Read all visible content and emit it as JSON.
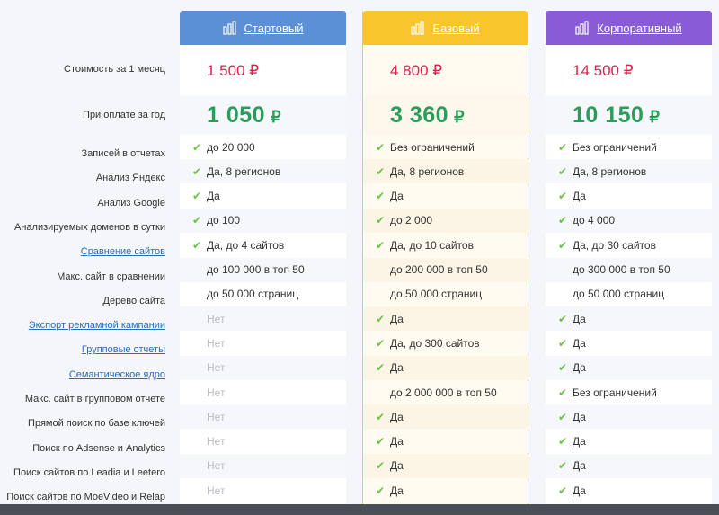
{
  "labels": {
    "monthly_cost": "Стоимость за 1 месяц",
    "yearly_payment": "При оплате за год",
    "features": [
      {
        "text": "Записей в отчетах",
        "link": false
      },
      {
        "text": "Анализ Яндекс",
        "link": false
      },
      {
        "text": "Анализ Google",
        "link": false
      },
      {
        "text": "Анализируемых доменов в сутки",
        "link": false
      },
      {
        "text": "Сравнение сайтов",
        "link": true
      },
      {
        "text": "Макс. сайт в сравнении",
        "link": false
      },
      {
        "text": "Дерево сайта",
        "link": false
      },
      {
        "text": "Экспорт рекламной кампании",
        "link": true
      },
      {
        "text": "Групповые отчеты",
        "link": true
      },
      {
        "text": "Семантическое ядро",
        "link": true
      },
      {
        "text": "Макс. сайт в групповом отчете",
        "link": false
      },
      {
        "text": "Прямой поиск по базе ключей",
        "link": false
      },
      {
        "text": "Поиск по Adsense и Analytics",
        "link": false
      },
      {
        "text": "Поиск сайтов по Leadia и Leetero",
        "link": false
      },
      {
        "text": "Поиск сайтов по MoeVideo и Relap",
        "link": false
      }
    ]
  },
  "plans": [
    {
      "key": "start",
      "name": "Стартовый",
      "color": "#5b8fd6",
      "month_price": "1 500 ₽",
      "year_price": "1 050",
      "currency": "₽",
      "values": [
        {
          "text": "до 20 000",
          "state": "check"
        },
        {
          "text": "Да, 8 регионов",
          "state": "check"
        },
        {
          "text": "Да",
          "state": "check"
        },
        {
          "text": "до 100",
          "state": "check"
        },
        {
          "text": "Да, до 4 сайтов",
          "state": "check"
        },
        {
          "text": "до 100 000 в топ 50",
          "state": "plain"
        },
        {
          "text": "до 50 000 страниц",
          "state": "plain"
        },
        {
          "text": "Нет",
          "state": "no"
        },
        {
          "text": "Нет",
          "state": "no"
        },
        {
          "text": "Нет",
          "state": "no"
        },
        {
          "text": "Нет",
          "state": "no"
        },
        {
          "text": "Нет",
          "state": "no"
        },
        {
          "text": "Нет",
          "state": "no"
        },
        {
          "text": "Нет",
          "state": "no"
        },
        {
          "text": "Нет",
          "state": "no"
        }
      ]
    },
    {
      "key": "basic",
      "name": "Базовый",
      "color": "#f7c52c",
      "month_price": "4 800 ₽",
      "year_price": "3 360",
      "currency": "₽",
      "values": [
        {
          "text": "Без ограничений",
          "state": "check"
        },
        {
          "text": "Да, 8 регионов",
          "state": "check"
        },
        {
          "text": "Да",
          "state": "check"
        },
        {
          "text": "до 2 000",
          "state": "check"
        },
        {
          "text": "Да, до 10 сайтов",
          "state": "check"
        },
        {
          "text": "до 200 000 в топ 50",
          "state": "plain"
        },
        {
          "text": "до 50 000 страниц",
          "state": "plain"
        },
        {
          "text": "Да",
          "state": "check"
        },
        {
          "text": "Да, до 300 сайтов",
          "state": "check"
        },
        {
          "text": "Да",
          "state": "check"
        },
        {
          "text": "до 2 000 000 в топ 50",
          "state": "plain"
        },
        {
          "text": "Да",
          "state": "check"
        },
        {
          "text": "Да",
          "state": "check"
        },
        {
          "text": "Да",
          "state": "check"
        },
        {
          "text": "Да",
          "state": "check"
        }
      ]
    },
    {
      "key": "corp",
      "name": "Корпоративный",
      "color": "#8a5bd6",
      "month_price": "14 500 ₽",
      "year_price": "10 150",
      "currency": "₽",
      "values": [
        {
          "text": "Без ограничений",
          "state": "check"
        },
        {
          "text": "Да, 8 регионов",
          "state": "check"
        },
        {
          "text": "Да",
          "state": "check"
        },
        {
          "text": "до 4 000",
          "state": "check"
        },
        {
          "text": "Да, до 30 сайтов",
          "state": "check"
        },
        {
          "text": "до 300 000 в топ 50",
          "state": "plain"
        },
        {
          "text": "до 50 000 страниц",
          "state": "plain"
        },
        {
          "text": "Да",
          "state": "check"
        },
        {
          "text": "Да",
          "state": "check"
        },
        {
          "text": "Да",
          "state": "check"
        },
        {
          "text": "Без ограничений",
          "state": "check"
        },
        {
          "text": "Да",
          "state": "check"
        },
        {
          "text": "Да",
          "state": "check"
        },
        {
          "text": "Да",
          "state": "check"
        },
        {
          "text": "Да",
          "state": "check"
        }
      ]
    }
  ],
  "icons": {
    "plan_icon": "bar-chart-icon",
    "check_icon": "check-icon"
  }
}
